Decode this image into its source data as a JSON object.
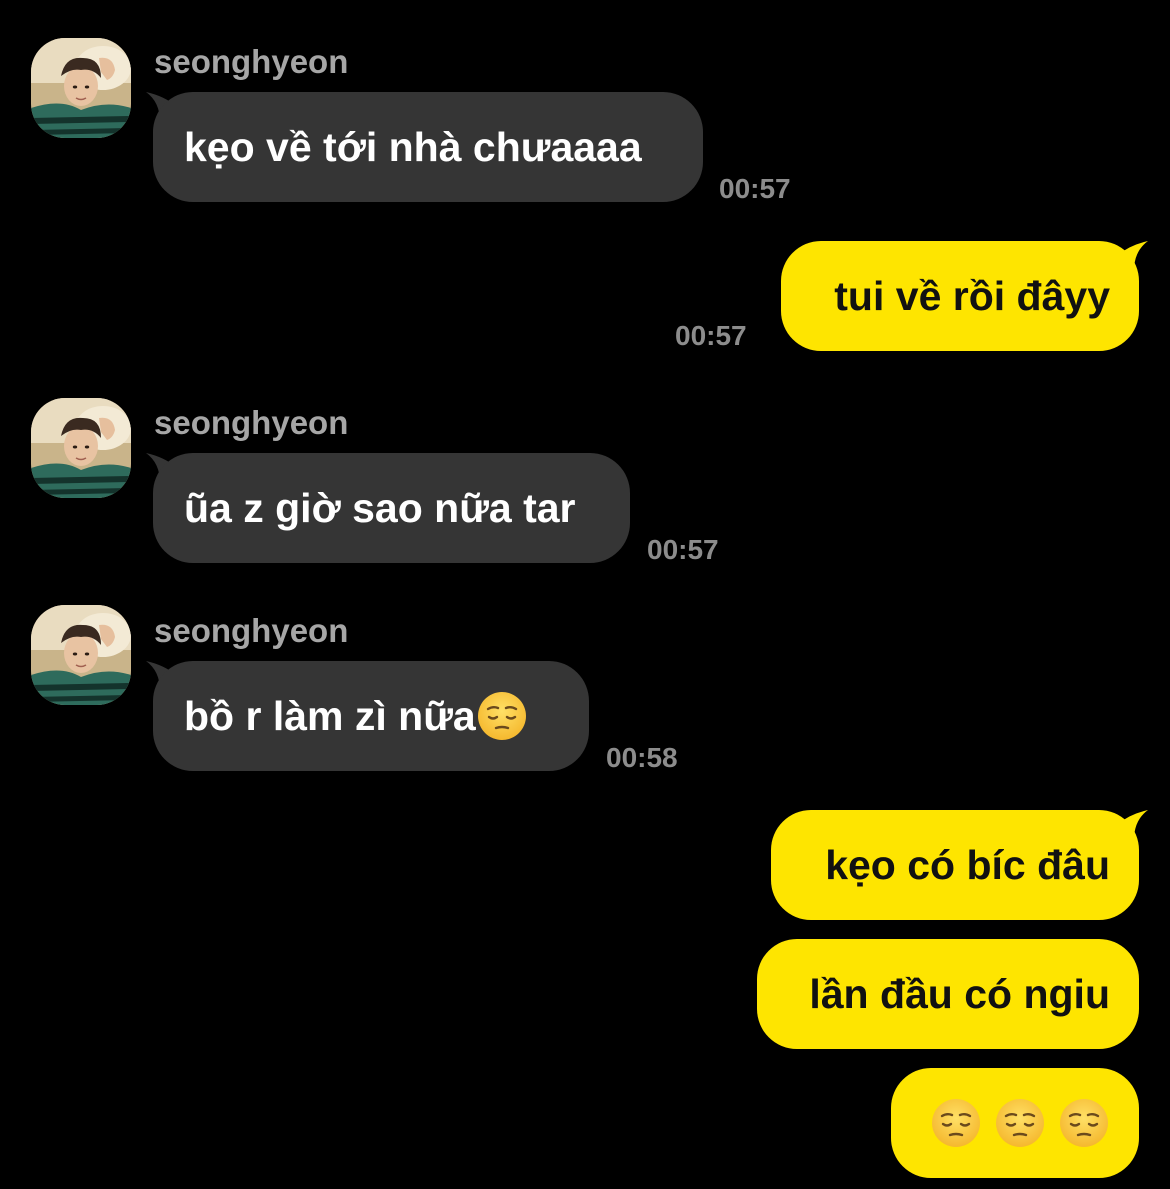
{
  "conversation": {
    "accent_incoming": "#353535",
    "accent_outgoing": "#fee500",
    "messages": [
      {
        "direction": "incoming",
        "sender": "seonghyeon",
        "text": "kẹo về tới nhà chưaaaa",
        "time": "00:57",
        "avatar_icon": "profile-photo"
      },
      {
        "direction": "outgoing",
        "text": "tui về rồi đâyy",
        "time": "00:57"
      },
      {
        "direction": "incoming",
        "sender": "seonghyeon",
        "text": "ũa z giờ sao nữa tar",
        "time": "00:57",
        "avatar_icon": "profile-photo"
      },
      {
        "direction": "incoming",
        "sender": "seonghyeon",
        "text": "bồ r làm zì nữa",
        "emoji": "pensive-face-icon",
        "time": "00:58",
        "avatar_icon": "profile-photo"
      },
      {
        "direction": "outgoing",
        "text": "kẹo có bíc đâu"
      },
      {
        "direction": "outgoing",
        "text": "lần đầu có ngiu"
      },
      {
        "direction": "outgoing",
        "emoji": [
          "pensive-face-icon",
          "pensive-face-icon",
          "pensive-face-icon"
        ]
      }
    ]
  }
}
